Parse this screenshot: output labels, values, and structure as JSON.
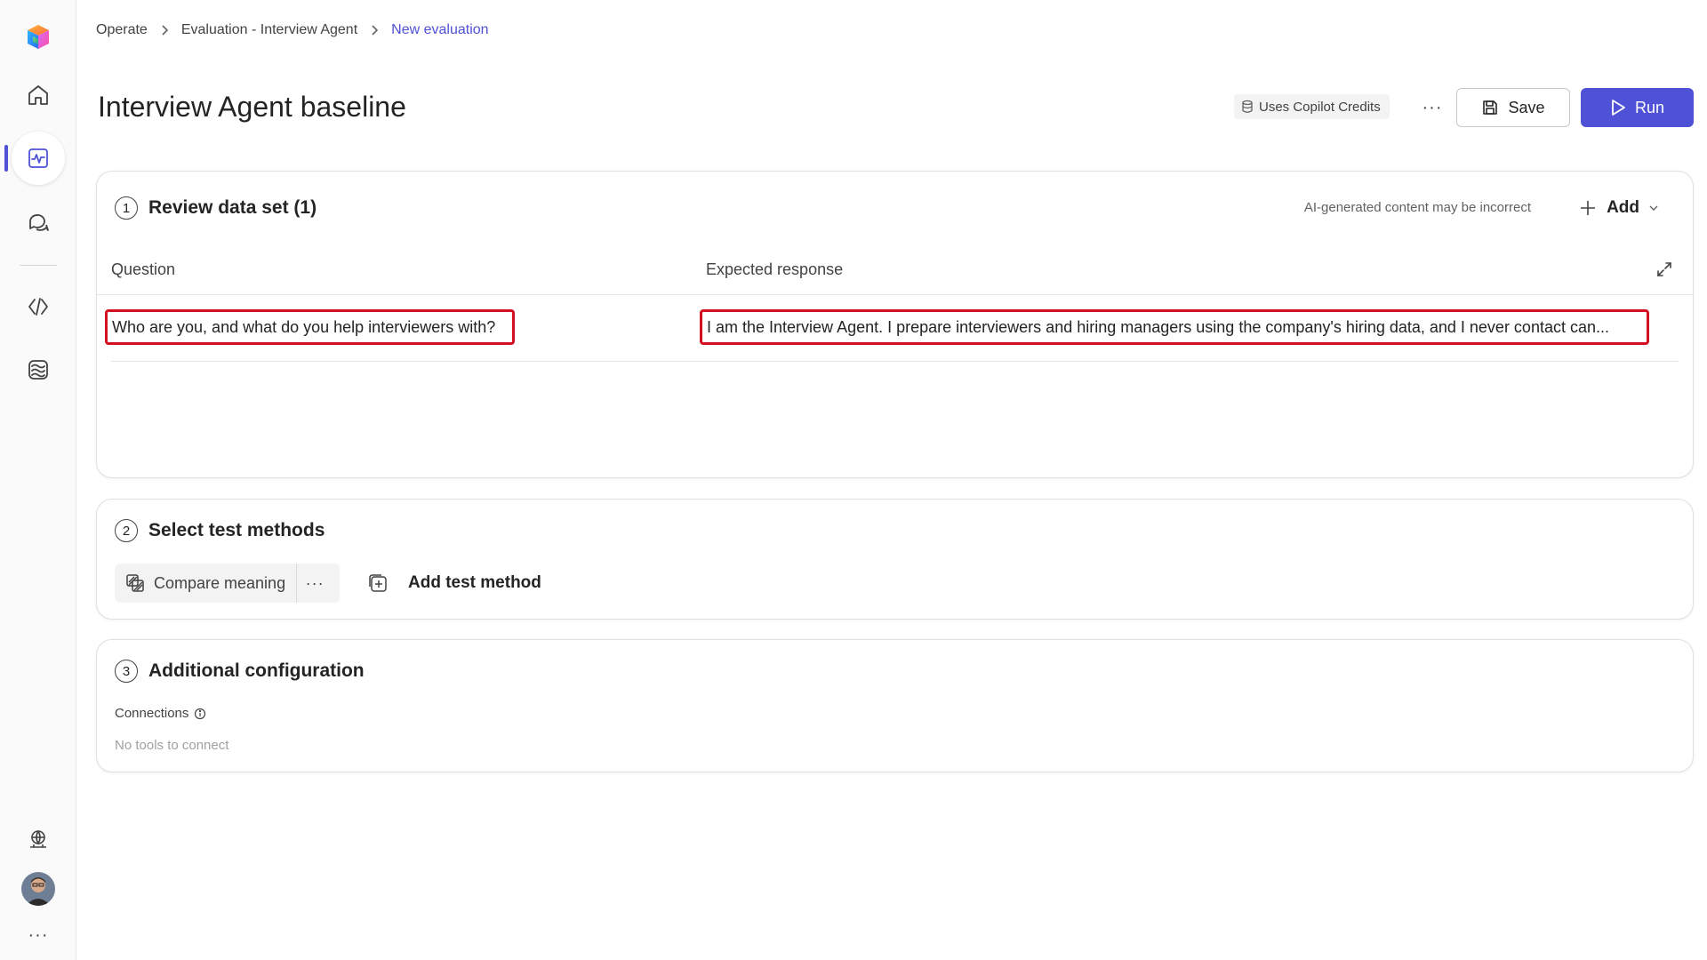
{
  "breadcrumb": {
    "items": [
      "Operate",
      "Evaluation - Interview Agent",
      "New evaluation"
    ]
  },
  "page": {
    "title": "Interview Agent baseline"
  },
  "actions": {
    "credits_label": "Uses Copilot Credits",
    "more_label": "···",
    "save_label": "Save",
    "run_label": "Run"
  },
  "review": {
    "step": "1",
    "title": "Review data set (1)",
    "ai_note": "AI-generated content may be incorrect",
    "add_label": "Add",
    "columns": [
      "Question",
      "Expected response"
    ],
    "rows": [
      {
        "question": "Who are you, and what do you help interviewers with?",
        "expected": "I am the Interview Agent. I prepare interviewers and hiring managers using the company's hiring data, and I never contact can..."
      }
    ]
  },
  "methods": {
    "step": "2",
    "title": "Select test methods",
    "chip_label": "Compare meaning",
    "chip_more": "···",
    "add_label": "Add test method"
  },
  "config": {
    "step": "3",
    "title": "Additional configuration",
    "connections_label": "Connections",
    "connections_empty": "No tools to connect"
  },
  "rail": {
    "more_label": "···"
  },
  "colors": {
    "accent": "#4f52d6",
    "highlight": "#d50f1f"
  }
}
